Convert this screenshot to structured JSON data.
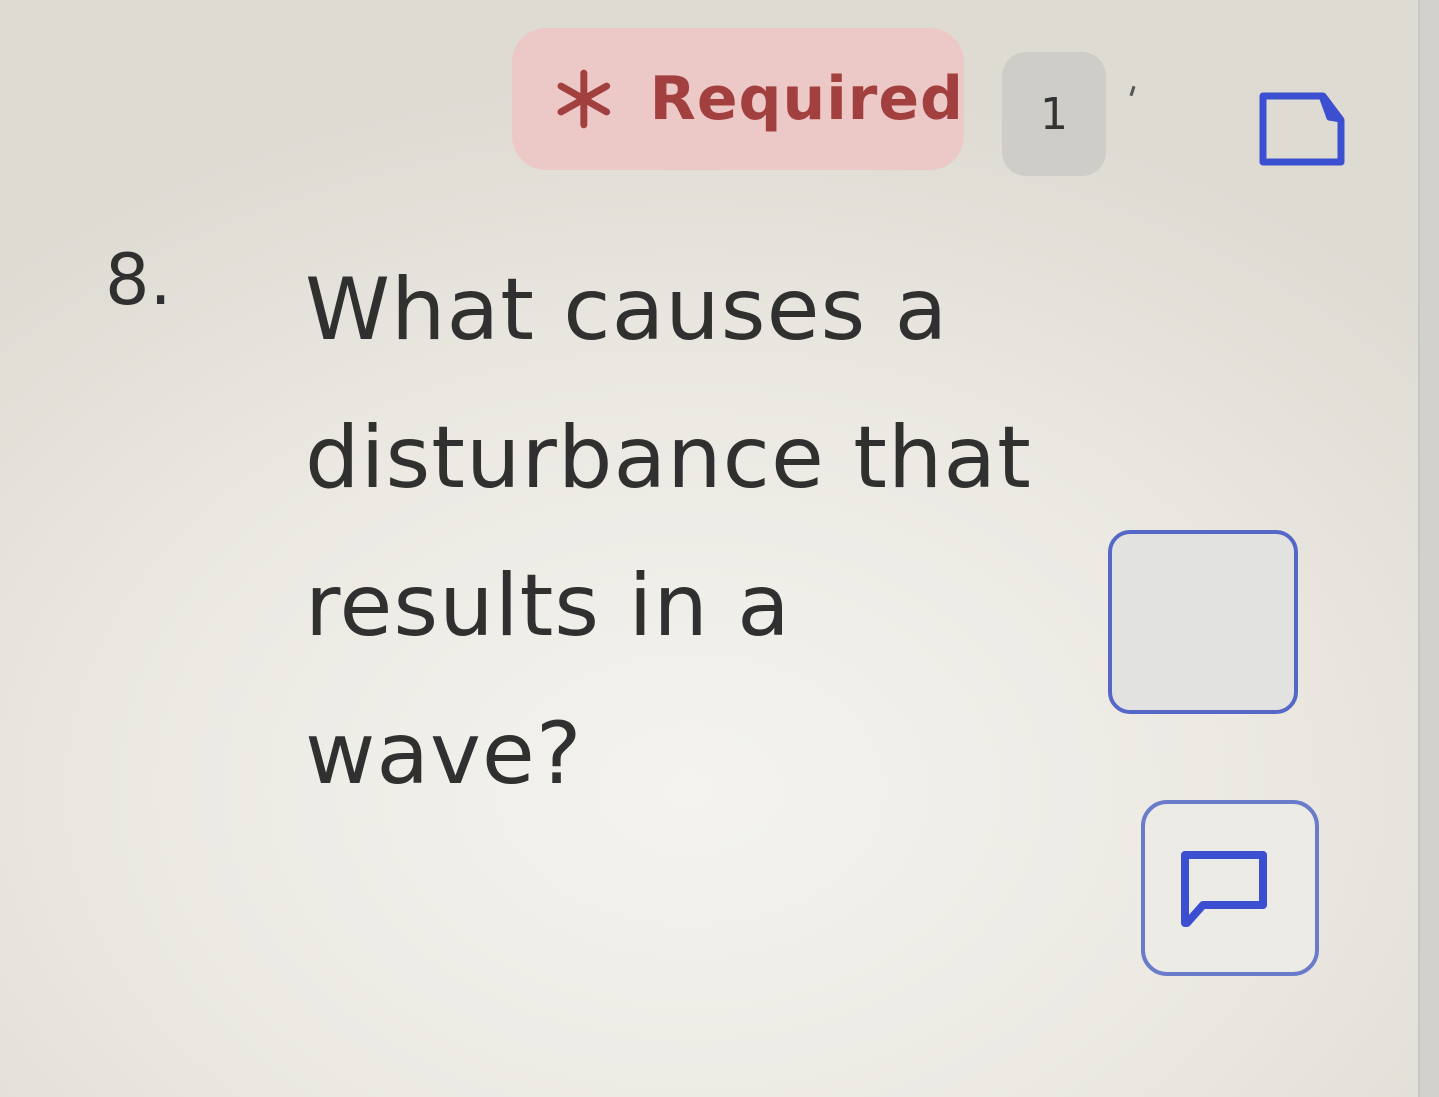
{
  "header": {
    "required_label": "Required",
    "points_label": "1",
    "accent_color": "#3c4fd0",
    "required_color": "#a2403f"
  },
  "question": {
    "number": "8.",
    "text": "What causes a disturbance that results in a wave?"
  },
  "icons": {
    "required": "asterisk-icon",
    "bookmark": "tag-icon",
    "comment": "comment-icon"
  }
}
